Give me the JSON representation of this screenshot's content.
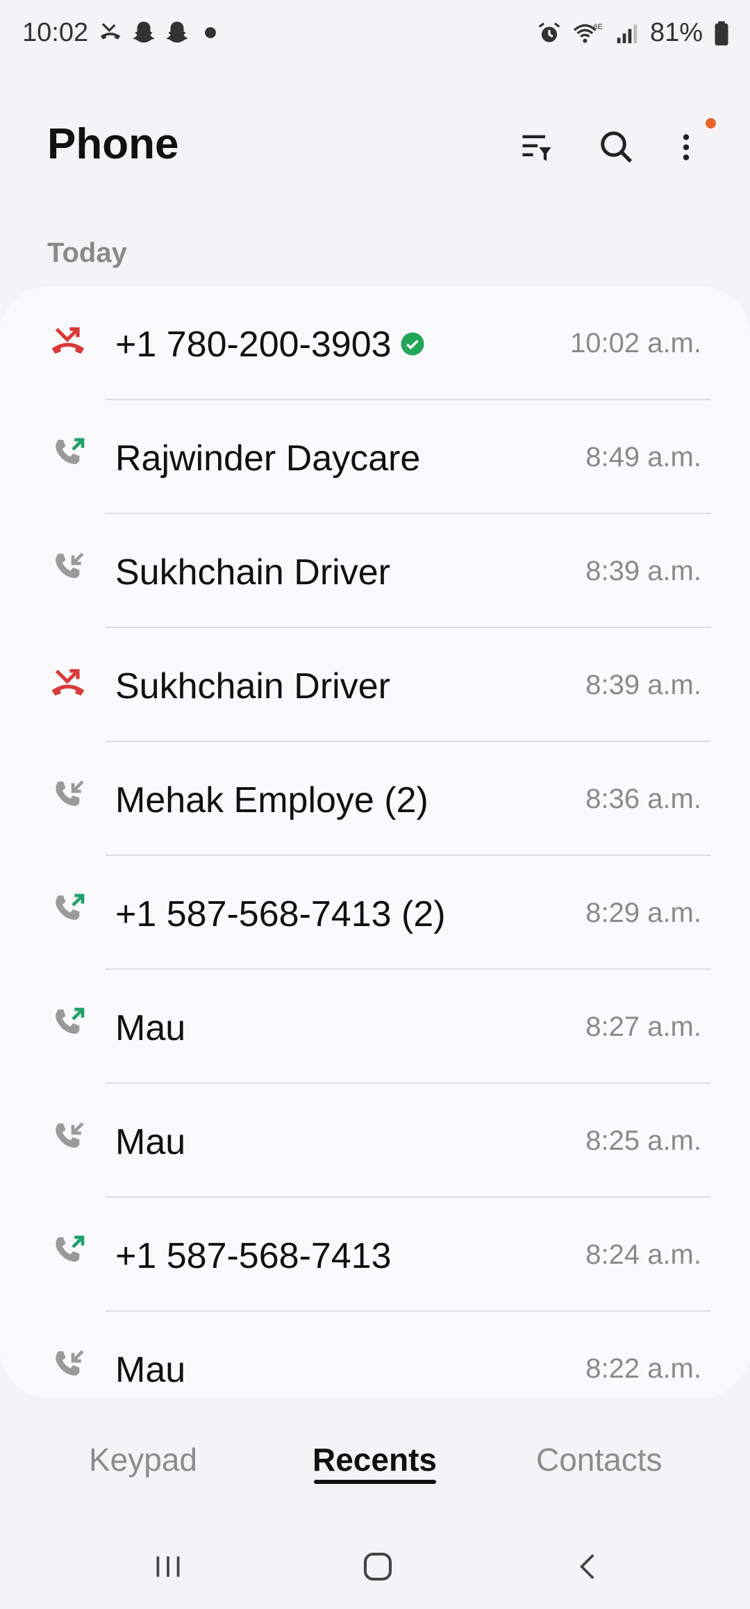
{
  "status_bar": {
    "time": "10:02",
    "battery": "81%",
    "left_icons": [
      "missed-call-icon",
      "snapchat-icon",
      "snapchat-icon",
      "dot-icon"
    ],
    "right_icons": [
      "alarm-icon",
      "wifi-6e-icon",
      "signal-icon",
      "battery-icon"
    ]
  },
  "header": {
    "title": "Phone",
    "actions": [
      "filter-icon",
      "search-icon",
      "more-options-icon"
    ],
    "notification_dot_color": "#e8632b"
  },
  "section": {
    "label": "Today"
  },
  "calls": [
    {
      "name": "+1 780-200-3903",
      "time": "10:02 a.m.",
      "type": "missed",
      "verified": true
    },
    {
      "name": "Rajwinder Daycare",
      "time": "8:49 a.m.",
      "type": "outgoing"
    },
    {
      "name": "Sukhchain Driver",
      "time": "8:39 a.m.",
      "type": "incoming"
    },
    {
      "name": "Sukhchain Driver",
      "time": "8:39 a.m.",
      "type": "missed"
    },
    {
      "name": "Mehak Employe (2)",
      "time": "8:36 a.m.",
      "type": "incoming"
    },
    {
      "name": "+1 587-568-7413 (2)",
      "time": "8:29 a.m.",
      "type": "outgoing"
    },
    {
      "name": "Mau",
      "time": "8:27 a.m.",
      "type": "outgoing"
    },
    {
      "name": "Mau",
      "time": "8:25 a.m.",
      "type": "incoming"
    },
    {
      "name": "+1 587-568-7413",
      "time": "8:24 a.m.",
      "type": "outgoing"
    },
    {
      "name": "Mau",
      "time": "8:22 a.m.",
      "type": "incoming"
    }
  ],
  "tabs": [
    {
      "label": "Keypad",
      "active": false
    },
    {
      "label": "Recents",
      "active": true
    },
    {
      "label": "Contacts",
      "active": false
    }
  ],
  "colors": {
    "missed": "#d93a3a",
    "outgoing_arrow": "#1fa26a",
    "incoming_arrow": "#9a9a9a",
    "handset": "#9a9a9a",
    "verified": "#22a65a"
  }
}
